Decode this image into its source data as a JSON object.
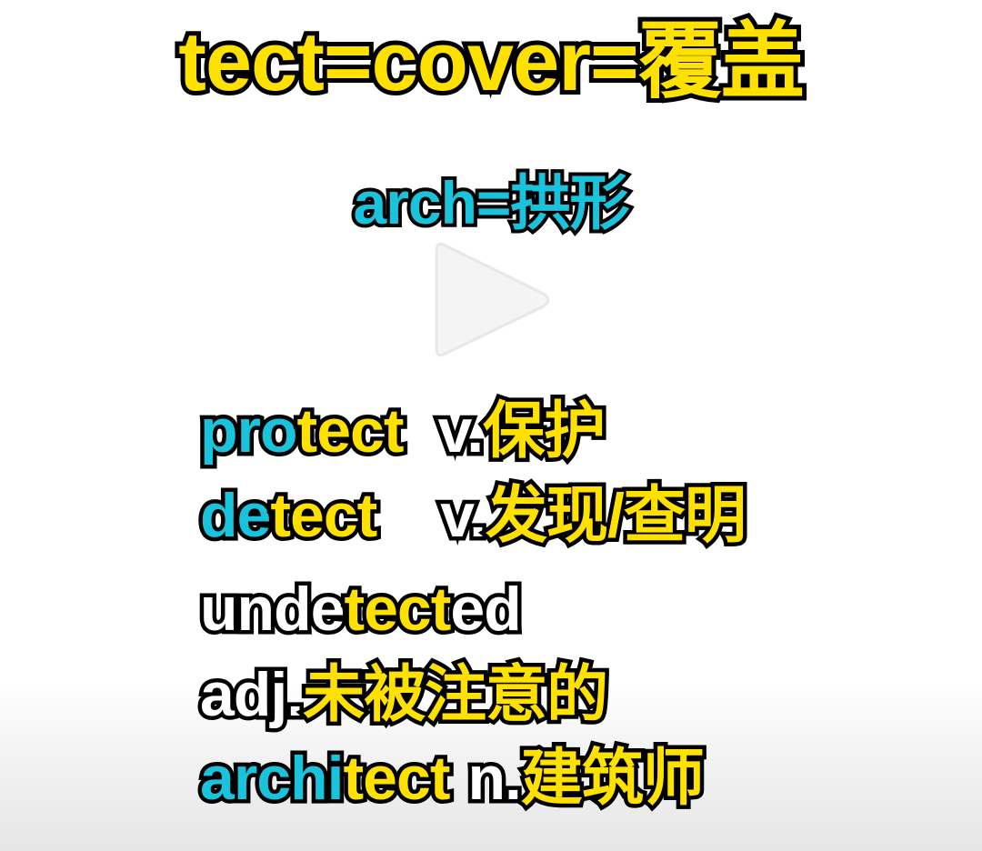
{
  "title": {
    "text": "tect=cover=覆盖"
  },
  "subtitle": {
    "text": "arch=拱形"
  },
  "play_overlay": {
    "icon": "play-icon"
  },
  "entries": {
    "protect": {
      "prefix": "pro",
      "root": "tect",
      "pos": "v.",
      "meaning": "保护"
    },
    "detect": {
      "prefix": "de",
      "root": "tect",
      "pos": "v.",
      "meaning": "发现/查明"
    },
    "undetected": {
      "prefix": "unde",
      "root": "tect",
      "suffix": "ed"
    },
    "undetected_meaning": {
      "pos": "adj.",
      "meaning": "未被注意的"
    },
    "architect": {
      "prefix": "archi",
      "root": "tect",
      "pos": "n.",
      "meaning": "建筑师"
    }
  },
  "colors": {
    "highlight": "#ffe100",
    "accent": "#19c3dc",
    "text": "#ffffff",
    "outline": "#000000"
  }
}
